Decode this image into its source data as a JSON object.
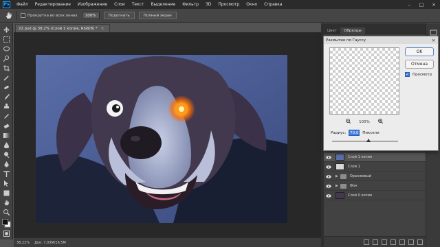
{
  "app": {
    "logo": "Ps"
  },
  "menu": [
    "Файл",
    "Редактирование",
    "Изображение",
    "Слои",
    "Текст",
    "Выделение",
    "Фильтр",
    "3D",
    "Просмотр",
    "Окно",
    "Справка"
  ],
  "options": {
    "scroll_all_windows": "Прокрутка во всех окнах",
    "zoom_value": "100%",
    "fit_screen": "Подогнать",
    "full_screen": "Полный экран"
  },
  "document": {
    "tab_title": "22.psd @ 38,2% (Слой 1 копия, RGB/8) *",
    "close_glyph": "×"
  },
  "status": {
    "zoom": "38,22%",
    "doc_info": "Док: 7,03M/16,5M"
  },
  "panel_tabs": [
    "Цвет",
    "Образцы"
  ],
  "layers": [
    {
      "name": "Слой 1 копия",
      "kind": "layer"
    },
    {
      "name": "Слой 1",
      "kind": "layer"
    },
    {
      "name": "Оранжевый",
      "kind": "group"
    },
    {
      "name": "Фон",
      "kind": "group"
    },
    {
      "name": "Слой 0 копия",
      "kind": "layer"
    }
  ],
  "dialog": {
    "title": "Размытие по Гауссу",
    "ok": "OK",
    "cancel": "Отмена",
    "preview_label": "Просмотр",
    "zoom": "100%",
    "radius_label": "Радиус:",
    "radius_value": "70,0",
    "radius_unit": "Пиксели",
    "radius_slider_level": 0.55
  },
  "colors": {
    "accent": "#31a8ff",
    "eye_glow": "#ff9a1a",
    "selection": "#3d7fe0"
  },
  "icons": [
    "photoshop-logo-icon",
    "hand-icon",
    "eye-icon",
    "folder-icon",
    "close-icon",
    "zoom-in-icon",
    "zoom-out-icon"
  ]
}
